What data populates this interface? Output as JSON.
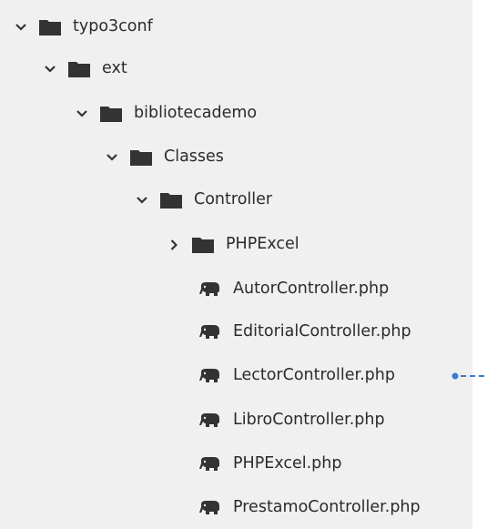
{
  "tree": {
    "rows": [
      {
        "label": "typo3conf",
        "kind": "folder",
        "expanded": true
      },
      {
        "label": "ext",
        "kind": "folder",
        "expanded": true
      },
      {
        "label": "bibliotecademo",
        "kind": "folder",
        "expanded": true
      },
      {
        "label": "Classes",
        "kind": "folder",
        "expanded": true
      },
      {
        "label": "Controller",
        "kind": "folder",
        "expanded": true
      },
      {
        "label": "PHPExcel",
        "kind": "folder",
        "expanded": false
      },
      {
        "label": "AutorController.php",
        "kind": "php-file"
      },
      {
        "label": "EditorialController.php",
        "kind": "php-file"
      },
      {
        "label": "LectorController.php",
        "kind": "php-file",
        "annotated": true
      },
      {
        "label": "LibroController.php",
        "kind": "php-file"
      },
      {
        "label": "PHPExcel.php",
        "kind": "php-file"
      },
      {
        "label": "PrestamoController.php",
        "kind": "php-file"
      }
    ]
  },
  "colors": {
    "panel_background": "#f0f0f0",
    "icon": "#333333",
    "text": "#2b2b2b",
    "annotation": "#3a7bd5"
  }
}
